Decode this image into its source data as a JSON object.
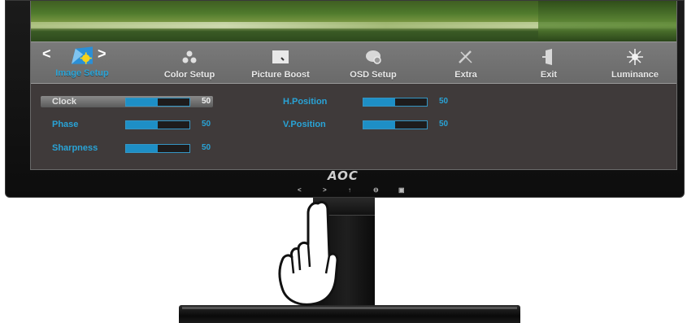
{
  "menu": {
    "tabs": [
      {
        "label": "Image Setup",
        "icon": "image-setup-icon",
        "active": true
      },
      {
        "label": "Color Setup",
        "icon": "color-setup-icon",
        "active": false
      },
      {
        "label": "Picture Boost",
        "icon": "picture-boost-icon",
        "active": false
      },
      {
        "label": "OSD Setup",
        "icon": "osd-setup-icon",
        "active": false
      },
      {
        "label": "Extra",
        "icon": "extra-icon",
        "active": false
      },
      {
        "label": "Exit",
        "icon": "exit-icon",
        "active": false
      },
      {
        "label": "Luminance",
        "icon": "luminance-icon",
        "active": false
      }
    ],
    "prev_arrow": "<",
    "next_arrow": ">"
  },
  "settings": {
    "left": [
      {
        "label": "Clock",
        "value": "50",
        "level": 0.5,
        "selected": true
      },
      {
        "label": "Phase",
        "value": "50",
        "level": 0.5,
        "selected": false
      },
      {
        "label": "Sharpness",
        "value": "50",
        "level": 0.5,
        "selected": false
      }
    ],
    "right": [
      {
        "label": "H.Position",
        "value": "50",
        "level": 0.5
      },
      {
        "label": "V.Position",
        "value": "50",
        "level": 0.5
      }
    ]
  },
  "bezel": {
    "logo": "AOC",
    "buttons": [
      "<",
      ">",
      "↑",
      "⊖",
      "▣"
    ]
  },
  "colors": {
    "accent": "#29a3d6",
    "slider_fill": "#1e8fc6",
    "panel_bg": "#3f3a3a",
    "menu_bar": "#707070"
  }
}
